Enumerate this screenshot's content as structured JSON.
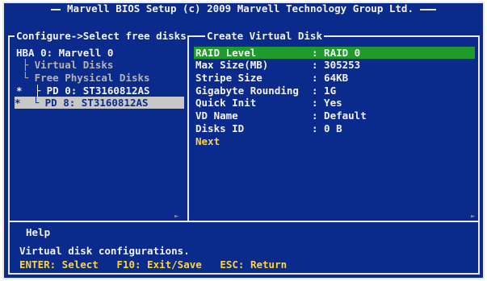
{
  "header": {
    "title": "Marvell BIOS Setup (c) 2009 Marvell Technology Group Ltd."
  },
  "left_panel": {
    "legend": "Configure->Select free disks",
    "items": [
      {
        "label": "HBA 0: Marvell 0",
        "color": "#f2f2f2"
      },
      {
        "label": " ├ Virtual Disks",
        "color": "#b4b4b4"
      },
      {
        "label": " └ Free Physical Disks",
        "color": "#b4b4b4"
      },
      {
        "label": "*  ├ PD 0: ST3160812AS",
        "color": "#f2f2f2"
      },
      {
        "label": "*  └ PD 8: ST3160812AS",
        "color": "#0a2a8c",
        "selected": true
      }
    ]
  },
  "right_panel": {
    "legend": "Create Virtual Disk",
    "fields": [
      {
        "label": "RAID Level       ",
        "value": ": RAID 0"
      },
      {
        "label": "Max Size(MB)     ",
        "value": ": 305253"
      },
      {
        "label": "Stripe Size      ",
        "value": ": 64KB"
      },
      {
        "label": "Gigabyte Rounding",
        "value": ": 1G"
      },
      {
        "label": "Quick Init       ",
        "value": ": Yes"
      },
      {
        "label": "VD Name          ",
        "value": ": Default"
      },
      {
        "label": "Disks ID         ",
        "value": ": 0 B"
      }
    ],
    "next_label": "Next"
  },
  "help": {
    "legend": "Help",
    "description": "Virtual disk configurations.",
    "keys": "ENTER: Select   F10: Exit/Save   ESC: Return"
  },
  "colors": {
    "background": "#0a2a8c",
    "border": "#e8e8e8",
    "highlight_green": "#1f9a2c",
    "highlight_gray": "#c8c8c8",
    "accent_yellow": "#ffd43a"
  }
}
